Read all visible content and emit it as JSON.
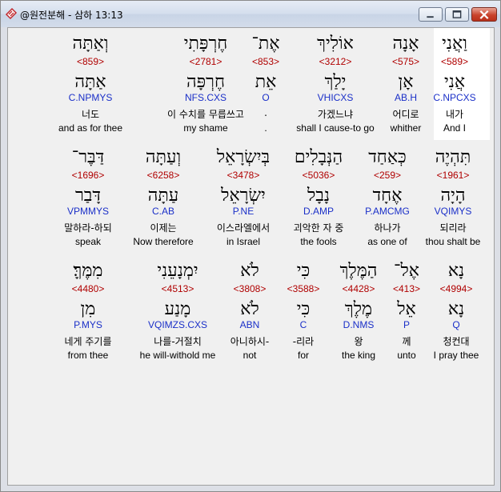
{
  "window": {
    "title": "@원전분해 - 삼하 13:13"
  },
  "rows": [
    {
      "words": [
        {
          "heb": "וַאֲנִי",
          "num": "<589>",
          "lemma": "אֲנִי",
          "parse": "C.NPCXS",
          "kor": "내가",
          "eng": "And I"
        },
        {
          "heb": "אָנָה",
          "num": "<575>",
          "lemma": "אָן",
          "parse": "AB.H",
          "kor": "어디로",
          "eng": "whither"
        },
        {
          "heb": "אוֹלִיךְ",
          "num": "<3212>",
          "lemma": "יָלַךְ",
          "parse": "VHICXS",
          "kor": "가겠느냐",
          "eng": "shall I cause-to go"
        },
        {
          "heb": "אֶת־",
          "num": "<853>",
          "lemma": "אֵת",
          "parse": "O",
          "kor": ".",
          "eng": "."
        },
        {
          "heb": "חֶרְפָּתִי",
          "num": "<2781>",
          "lemma": "חֶרְפָּה",
          "parse": "NFS.CXS",
          "kor": "이 수치를 무릅쓰고",
          "eng": "my shame"
        },
        {
          "heb": "וְאַתָּה",
          "num": "<859>",
          "lemma": "אַתָּה",
          "parse": "C.NPMYS",
          "kor": "너도",
          "eng": "and as for thee"
        }
      ]
    },
    {
      "words": [
        {
          "heb": "תִּהְיֶה",
          "num": "<1961>",
          "lemma": "הָיָה",
          "parse": "VQIMYS",
          "kor": "되리라",
          "eng": "thou shalt be"
        },
        {
          "heb": "כְּאַחַד",
          "num": "<259>",
          "lemma": "אֶחָד",
          "parse": "P.AMCMG",
          "kor": "하나가",
          "eng": "as one of"
        },
        {
          "heb": "הַנְּבָלִים",
          "num": "<5036>",
          "lemma": "נָבָל",
          "parse": "D.AMP",
          "kor": "괴악한 자 중",
          "eng": "the fools"
        },
        {
          "heb": "בְּיִשְׂרָאֵל",
          "num": "<3478>",
          "lemma": "יִשְׂרָאֵל",
          "parse": "P.NE",
          "kor": "이스라엘에서",
          "eng": "in Israel"
        },
        {
          "heb": "וְעַתָּה",
          "num": "<6258>",
          "lemma": "עַתָּה",
          "parse": "C.AB",
          "kor": "이제는",
          "eng": "Now therefore"
        },
        {
          "heb": "דַּבֶּר־",
          "num": "<1696>",
          "lemma": "דָּבַר",
          "parse": "VPMMYS",
          "kor": "말하라-하되",
          "eng": "speak"
        }
      ]
    },
    {
      "words": [
        {
          "heb": "נָא",
          "num": "<4994>",
          "lemma": "נָא",
          "parse": "Q",
          "kor": "청컨대",
          "eng": "I pray thee"
        },
        {
          "heb": "אֶל־",
          "num": "<413>",
          "lemma": "אֵל",
          "parse": "P",
          "kor": "께",
          "eng": "unto"
        },
        {
          "heb": "הַמֶּלֶךְ",
          "num": "<4428>",
          "lemma": "מֶלֶךְ",
          "parse": "D.NMS",
          "kor": "왕",
          "eng": "the king"
        },
        {
          "heb": "כִּי",
          "num": "<3588>",
          "lemma": "כִּי",
          "parse": "C",
          "kor": "-리라",
          "eng": "for"
        },
        {
          "heb": "לֹא",
          "num": "<3808>",
          "lemma": "לֹא",
          "parse": "ABN",
          "kor": "아니하시-",
          "eng": "not"
        },
        {
          "heb": "יִמְנָעֵנִי",
          "num": "<4513>",
          "lemma": "מָנַע",
          "parse": "VQIMZS.CXS",
          "kor": "나를-거절치",
          "eng": "he will-withold me"
        },
        {
          "heb": "מִמֶּךָּ׃",
          "num": "<4480>",
          "lemma": "מִן",
          "parse": "P.MYS",
          "kor": "네게 주기를",
          "eng": "from thee"
        }
      ]
    }
  ]
}
